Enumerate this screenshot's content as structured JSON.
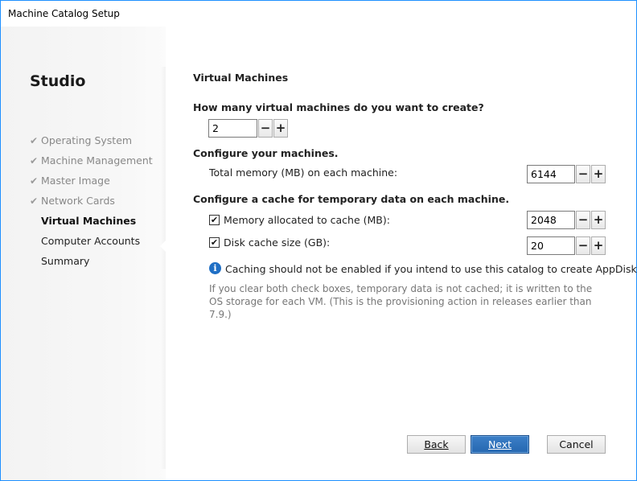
{
  "window": {
    "title": "Machine Catalog Setup"
  },
  "sidebar": {
    "brand": "Studio",
    "steps": [
      {
        "label": "Operating System",
        "state": "done"
      },
      {
        "label": "Machine Management",
        "state": "done"
      },
      {
        "label": "Master Image",
        "state": "done"
      },
      {
        "label": "Network Cards",
        "state": "done"
      },
      {
        "label": "Virtual Machines",
        "state": "current"
      },
      {
        "label": "Computer Accounts",
        "state": "pending"
      },
      {
        "label": "Summary",
        "state": "pending"
      }
    ],
    "check_glyph": "✔"
  },
  "main": {
    "heading": "Virtual Machines",
    "vm_count": {
      "question": "How many virtual machines do you want to create?",
      "value": "2"
    },
    "configure": {
      "heading": "Configure your machines.",
      "memory_label": "Total memory (MB) on each machine:",
      "memory_value": "6144"
    },
    "cache": {
      "heading": "Configure a cache for temporary data on each machine.",
      "memory_cache_label": "Memory allocated to cache (MB):",
      "memory_cache_value": "2048",
      "memory_cache_checked": true,
      "disk_cache_label": "Disk cache size (GB):",
      "disk_cache_value": "20",
      "disk_cache_checked": true
    },
    "info_text": "Caching should not be enabled if you intend to use this catalog to create AppDisks.",
    "note_text": "If you clear both check boxes, temporary data is not cached; it is written to the OS storage for each VM. (This is the provisioning action in releases earlier than 7.9.)",
    "minus_glyph": "−",
    "plus_glyph": "+",
    "check_glyph": "✔",
    "info_glyph": "i"
  },
  "footer": {
    "back_label": "Back",
    "next_label": "Next",
    "cancel_label": "Cancel"
  },
  "colors": {
    "window_border": "#1e90ff",
    "primary_button": "#2f74bf",
    "info_icon": "#1f6fc5"
  }
}
